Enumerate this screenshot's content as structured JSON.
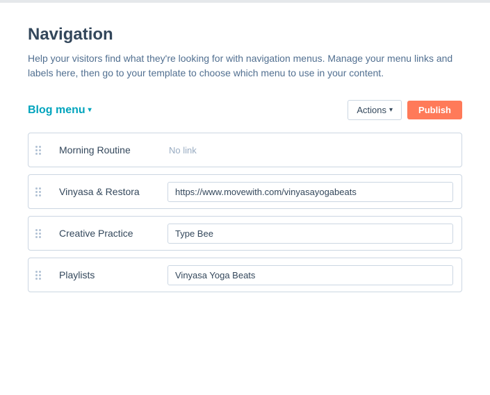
{
  "page": {
    "title": "Navigation",
    "description": "Help your visitors find what they're looking for with navigation menus. Manage your menu links and labels here, then go to your template to choose which menu to use in your content."
  },
  "menu": {
    "name": "Blog menu",
    "chevron": "▾"
  },
  "toolbar": {
    "actions_label": "Actions",
    "actions_arrow": "▾",
    "publish_label": "Publish"
  },
  "items": [
    {
      "id": "morning-routine",
      "name": "Morning Routine",
      "link": "",
      "link_placeholder": "",
      "no_link_text": "No link"
    },
    {
      "id": "vinyasa-restora",
      "name": "Vinyasa & Restora",
      "link": "https://www.movewith.com/vinyasayogabeats",
      "link_placeholder": ""
    },
    {
      "id": "creative-practice",
      "name": "Creative Practice",
      "link": "Type Bee",
      "link_placeholder": ""
    },
    {
      "id": "playlists",
      "name": "Playlists",
      "link": "Vinyasa Yoga Beats",
      "link_placeholder": ""
    }
  ]
}
